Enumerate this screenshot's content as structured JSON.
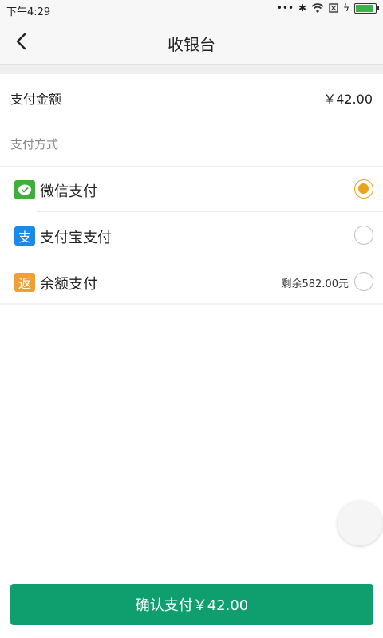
{
  "status_bar": {
    "time": "下午4:29",
    "icons": [
      "dots-icon",
      "bluetooth-icon",
      "wifi-icon",
      "sim-icon",
      "charging-icon",
      "battery-icon"
    ]
  },
  "nav": {
    "title": "收银台",
    "back_icon": "chevron-left-icon"
  },
  "amount": {
    "label": "支付金额",
    "value": "￥42.00"
  },
  "method_section": {
    "label": "支付方式"
  },
  "methods": [
    {
      "label": "微信支付",
      "icon": "wechat-pay-icon",
      "icon_color": "#3fae3b",
      "selected": true
    },
    {
      "label": "支付宝支付",
      "icon": "alipay-icon",
      "icon_glyph": "支",
      "icon_color": "#1e88e5",
      "selected": false
    },
    {
      "label": "余额支付",
      "icon": "balance-icon",
      "icon_glyph": "返",
      "icon_color": "#f0a033",
      "note": "剩余582.00元",
      "selected": false
    }
  ],
  "confirm": {
    "label": "确认支付￥42.00"
  },
  "colors": {
    "accent_green": "#0f9f6f",
    "selected_radio": "#e9a31a"
  }
}
